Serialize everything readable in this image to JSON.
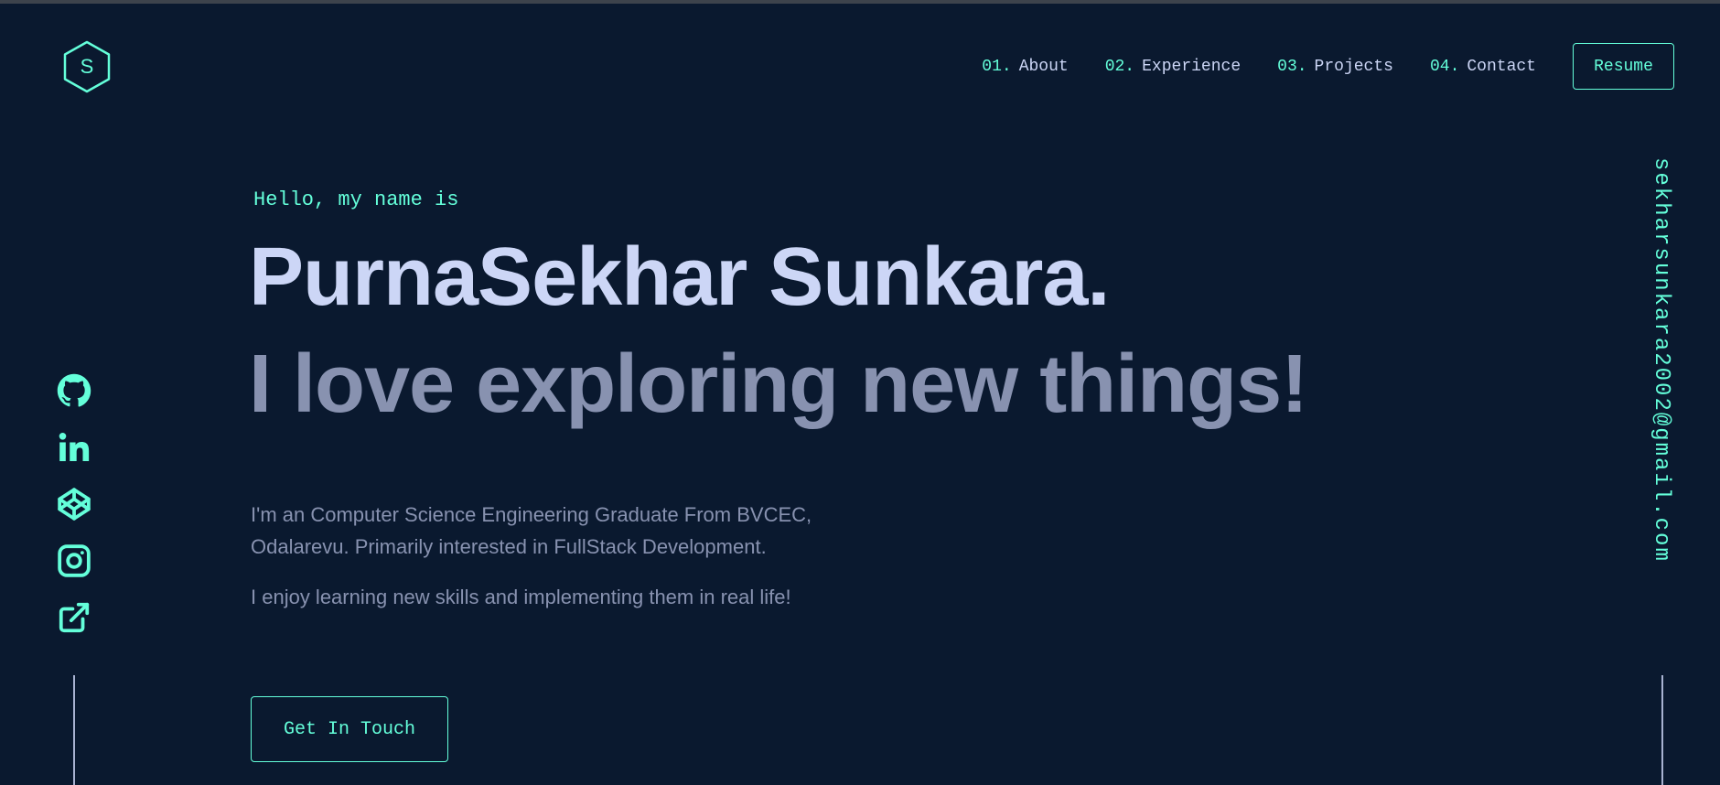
{
  "colors": {
    "background": "#0a192f",
    "accent": "#64ffda",
    "heading": "#ccd6f6",
    "text": "#8892b0"
  },
  "logo": {
    "letter": "S",
    "icon": "hexagon-logo-icon"
  },
  "nav": {
    "items": [
      {
        "num": "01.",
        "label": "About"
      },
      {
        "num": "02.",
        "label": "Experience"
      },
      {
        "num": "03.",
        "label": "Projects"
      },
      {
        "num": "04.",
        "label": "Contact"
      }
    ],
    "resume_label": "Resume"
  },
  "social": {
    "icons": [
      "github-icon",
      "linkedin-icon",
      "codepen-icon",
      "instagram-icon",
      "external-link-icon"
    ]
  },
  "email": "sekharsunkara2002@gmail.com",
  "hero": {
    "intro": "Hello, my name is",
    "name": "PurnaSekhar Sunkara.",
    "tagline": "I love exploring new things!",
    "description": "I'm an Computer Science Engineering Graduate From BVCEC, Odalarevu. Primarily interested in FullStack Development.",
    "description2": "I enjoy learning new skills and implementing them in real life!",
    "cta_label": "Get In Touch"
  }
}
